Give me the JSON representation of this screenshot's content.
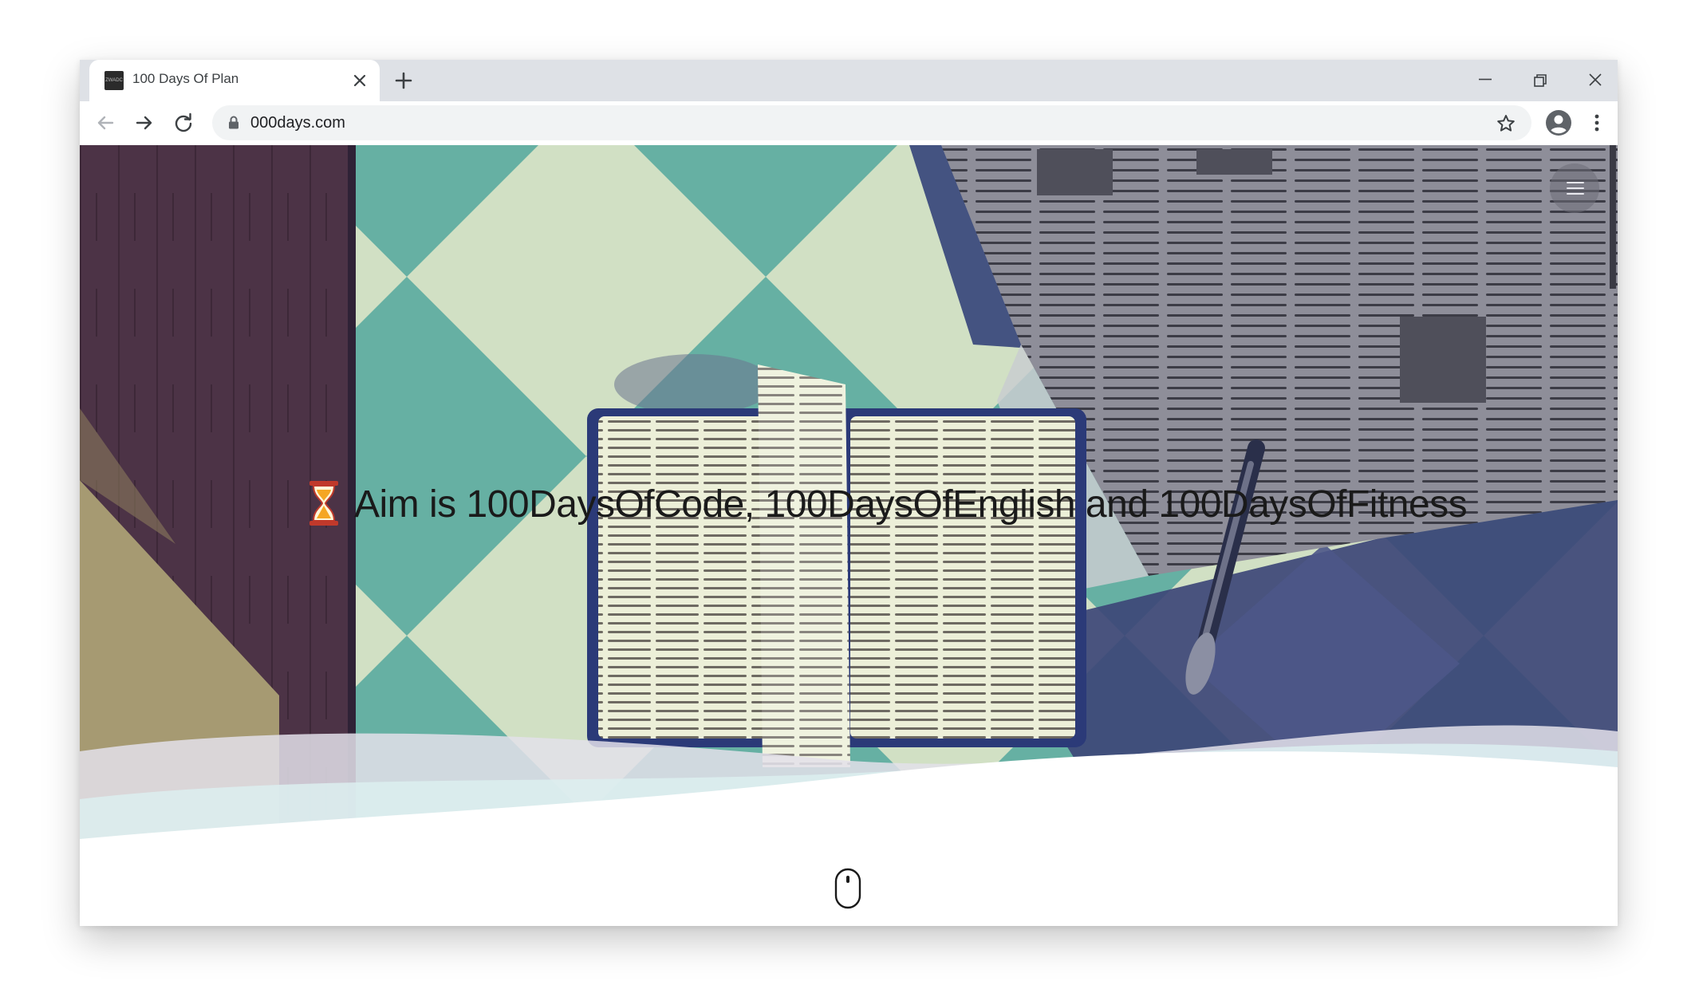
{
  "browser": {
    "tab": {
      "favicon_text": "ZWADC",
      "title": "100 Days Of Plan"
    },
    "url": "000days.com",
    "icons": {
      "tab_close": "close-icon",
      "new_tab": "plus-icon",
      "minimize": "minimize-icon",
      "restore": "restore-icon",
      "window_close": "close-icon",
      "back": "arrow-left-icon",
      "forward": "arrow-right-icon",
      "reload": "reload-icon",
      "lock": "lock-icon",
      "bookmark": "star-icon",
      "profile": "account-circle-icon",
      "menu": "more-vertical-icon"
    }
  },
  "page": {
    "headline": "Aim is 100DaysOfCode, 100DaysOfEnglish and 100DaysOfFitness",
    "icons": {
      "headline": "hourglass-icon",
      "nav_menu": "hamburger-icon",
      "scroll_hint": "mouse-icon"
    },
    "colors": {
      "hero_teal": "#66b0a3",
      "hero_cream": "#d1e0c4",
      "hero_navy": "#3d4677",
      "hero_wood": "#4c3346",
      "newspaper": "#8e8e99",
      "book_page": "#ecefd8"
    }
  }
}
